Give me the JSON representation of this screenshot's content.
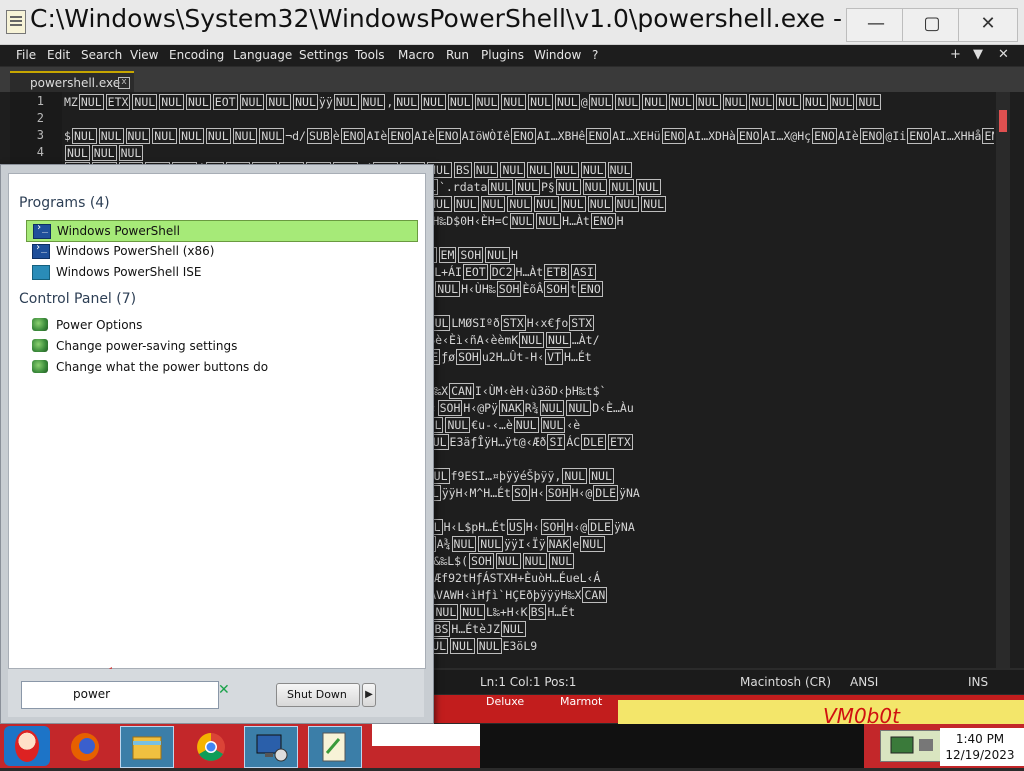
{
  "notepad": {
    "title": "C:\\Windows\\System32\\WindowsPowerShell\\v1.0\\powershell.exe - ...",
    "window_buttons": {
      "minimize": "—",
      "maximize": "▢",
      "close": "✕"
    },
    "menu": [
      "File",
      "Edit",
      "Search",
      "View",
      "Encoding",
      "Language",
      "Settings",
      "Tools",
      "Macro",
      "Run",
      "Plugins",
      "Window",
      "?"
    ],
    "menu_right": {
      "plus": "+",
      "dropdown": "▼",
      "close": "✕"
    },
    "tab": {
      "label": "powershell.exe",
      "close": "x"
    },
    "line_numbers": [
      "1",
      "2",
      "3",
      "4"
    ],
    "lines": [
      "MZ NUL ETX NUL NUL NUL EOT NUL NUL NUL ÿÿ NUL NUL , NUL NUL NUL NUL NUL NUL NUL @ NUL NUL NUL NUL NUL NUL NUL NUL NUL NUL NUL",
      "",
      "$ NUL NUL NUL NUL NUL NUL NUL NUL ¬d/ SUB è ENO AIè ENO AIè ENO AIöWÒIê ENO AI…XBHê ENO AI…XEHü ENO AI…XDHà ENO AI…X@Hç ENO AIè ENO @Ii ENO AI…XHHå ENO AI…",
      "NUL NUL NUL",
      "NUL NUL EOT NUL NUL Ý BS BEL NUL NUL ETX NUL ` Á NUL NUL NUL BS NUL NUL NUL NUL NUL NUL",
      "NUL NUL NUL NUL NUL NUL NUL NUL NUL NUL NUL NUL NUL NUL ` .rdata NUL NUL P§ NUL NUL NUL NUL",
      "NUL NUL NUL NUL NUL @ NUL NUL @ NUL NUL NUL NUL NUL NUL NUL NUL NUL NUL NUL NUL NUL NUL NUL",
      "ÌÌÌÌÌÌÌÌÌÌÌÌÌÌH‰\\$ DLE WHƒì » BS NUL NUL NUL ‹ÈèfhNUL NUL H‰D$0H‹ÈH=C NUL NUL H…Àt ENO H",
      "H…Àu(H‹ÈèESC H NUL NUL H…Àt DC3 H",
      "SOH NUL NUL NUL u FS H‹ÈèégNUL NUL H‰D$0H…Àt ETX H‰8H‰ ENO EM SOH NUL H",
      "yAºþÿÿ DEL D‹ÈI;ÂA»W NUL NUL BEL €E STX GÈE…Éx?D‹ÊH…Òt+L+öL+ÁI EOT DC2 H…Àt ETB ASI",
      "…Òt ETX fš EM H‹\\$ BS A‹ÁÃÌÌÌÌÌÌÌÌÌÌÌÌÌÌÌÌ@SHƒì HENO ÃŽ NUL NUL H‹ÙH‰ SOH ÈõÂ SOH t ENO",
      "",
      "êBEL H‹ GS dK SOH NUL H…öt;ƒe0 NUL H‹ÈY NAK ª¾ NUL NUL H ƒd$ NUL LMØSI ºð STX H‹x€ ƒ o STX",
      "ÌÌÌÌÌÌÌÌÌÌÌÌÌÌÌL‹[ BS I‰k DLE I‰s CAN WHƒì@IƒcèNUL‹ÂH‹ùISè‹Èì‹ñA‹èèmK NUL NUL …Àt/",
      "H‹t$HHƒÄ0_ÃÌÌÌÌÌÌH‰\\$ DLE WHƒì H‹ EM H‹ùH…ÛtCƒÈyð SI ÁC DLE ƒø SOH u2H…Ût-H‹ VT H…Ét",
      "",
      "ÌÌÌÌÌÌÌH‹Ä‰P DLE UVWATAUAVAWH l$Hìp SOH NUL NUL HÇEèþÿÿÿH‰X CAN I‹ÙM‹èH‹ù3öD‹þH‰t$`",
      "NUL ETB DC3 €SI„© ENO NUL NUL H‹L$XH…É SI„, ENO NUL NUL H‹ SOH H‹@Pÿ NAK R¾ NUL NUL D‹È…Àu",
      "NUL‹µÐ NUL NUL NUL M…Û SI„K ENO NUL NUL HEðH…Àt SI„, ENO NUL NUL €u-‹…è NUL NUL ‹è",
      ",ÿ SI NUL NUL f9EuVTA½ BS NUL NUL NUL fD‰mHMÿ NAK ÿ, NUL NUL E3äƒÎÿH…ÿt@‹Æð SI ÁC DLE ETX",
      "",
      "NUL ÿÿH‹M^H…Ét SO H‹ SOH H‹@ DLE ÿ NAK ƒ¹ NUL NUL, ÿ SI NUL NUL f9E SI…¤þÿÿéŠþÿÿ, NUL NUL",
      "NAK ˜, NUL NUL ë FFA, NUL NUL NUL ÿ NAK Š, NUL NUL A¾ NUL NUL ÿÿH‹M^H…Ét SO H‹ SOH H‹@ DLE ÿ NA",
      "ÿƒÎÿE3äé&ÿÿÿH‹",
      "NUL A¾ NUL NUL ÿÿH‹L$xH…Ét SO H‹ SOH H‹@ DLE ÿ NAK õ· NUL NUL H‹L$pH…Ét US H‹ SOH H‹@ DLE ÿ NA",
      "L$XA¾ NUL NUL ÿÿH…Ét NAK H‹ SOH H‹@ DLE ÿ NAK … NUL NUL ë ACK A¾ NUL NUL ÿÿI‹Ïÿ NAK e NUL",
      "W RS I‹ÑI‹È‹Ãf9 EM t   HETX IHƒê SOH uòH…Òu6H‹E, W NUL BEL €…Àx&‰L$( SOH NUL NUL NUL",
      "úL‹É» SOH NUL NUL NUL H…Òt~f;2tyD‹ÆH…Ét$A,ÿÿÿDEL I‹ÑA‹È‹Æf92t HƒÁSTXH+ÈuòH…ÉueL‹Á",
      "NUL @ŠPH‹t$HŠÃH‹\\$@HƒÄ0_ÃL+Áé2ÌÌÌÌÌÌÌH‹ÄH‰ BS USVWATAUAVAWH‹ìHƒì`HÇEðþÿÿÿH‰X CAN",
      "NUL ÈŠÿƒÎÿH…ÿt>‹Æð SI ÁC DLE ETX €u/H‹ ]ÐH‹ VT H…Ét  ÿ NAK w² NUL NUL L‰+H‹K BS H…Ét",
      "ÿ‹Æð SI ÁC DLE ETX €u4H‹]XH‹ VT H…Ét   ÿ NAK ±¯ NUL NUL L‰+H‹K BS H…Ét  èJZ NUL",
      "^AJA\\_^]ÃÌÌÌÌÌÌÌÌH‹ÄH‰ BS USVWAVH‹ìHƒì HÇEðþÿÿÿH‰X SOH NUL NUL NUL E3öL9"
    ],
    "status": {
      "pos": "Ln:1  Col:1  Pos:1",
      "eol": "Macintosh (CR)",
      "encoding": "ANSI",
      "mode": "INS"
    }
  },
  "start_menu": {
    "programs_heading": "Programs (4)",
    "programs": [
      "Windows PowerShell",
      "Windows PowerShell (x86)",
      "Windows PowerShell ISE"
    ],
    "control_panel_heading": "Control Panel (7)",
    "control_panel": [
      "Power Options",
      "Change power-saving settings",
      "Change what the power buttons do"
    ],
    "search_value": "power",
    "shutdown_label": "Shut Down"
  },
  "desktop": {
    "text1": "Deluxe",
    "text2": "Marmot",
    "banner": "VM0b0t"
  },
  "taskbar": {
    "clock_time": "1:40 PM",
    "clock_date": "12/19/2023"
  },
  "colors": {
    "selection": "#a6ea78",
    "taskbar": "#c3272a",
    "editor_bg": "#1e1e1e"
  }
}
